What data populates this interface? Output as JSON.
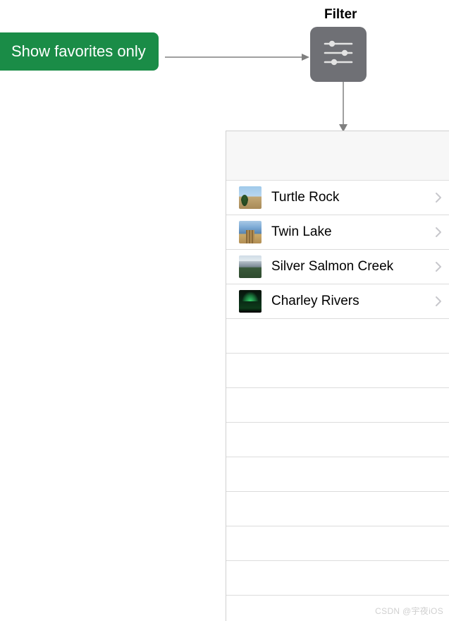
{
  "annotations": {
    "filter_label": "Filter",
    "callout": "Show favorites only"
  },
  "icons": {
    "filter": "sliders-icon"
  },
  "list": {
    "items": [
      {
        "title": "Turtle Rock",
        "thumb": "turtle"
      },
      {
        "title": "Twin Lake",
        "thumb": "twin"
      },
      {
        "title": "Silver Salmon Creek",
        "thumb": "silver"
      },
      {
        "title": "Charley Rivers",
        "thumb": "charley"
      }
    ],
    "empty_rows": 8
  },
  "watermark": "CSDN @宇夜iOS"
}
